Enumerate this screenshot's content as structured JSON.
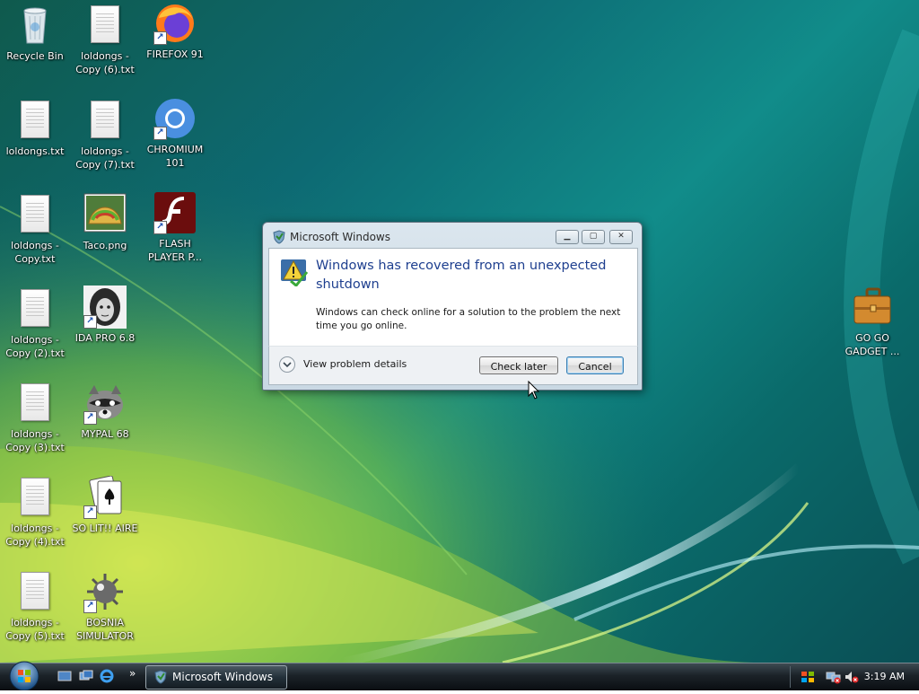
{
  "desktop_icons": [
    {
      "label": "Recycle Bin",
      "icon": "recycle-bin-icon"
    },
    {
      "label": "loldongs -\nCopy (6).txt",
      "icon": "text-file-icon"
    },
    {
      "label": "FIREFOX 91",
      "icon": "firefox-icon"
    },
    {
      "label": "loldongs.txt",
      "icon": "text-file-icon"
    },
    {
      "label": "loldongs -\nCopy (7).txt",
      "icon": "text-file-icon"
    },
    {
      "label": "CHROMIUM\n101",
      "icon": "chromium-icon"
    },
    {
      "label": "loldongs -\nCopy.txt",
      "icon": "text-file-icon"
    },
    {
      "label": "Taco.png",
      "icon": "image-file-icon"
    },
    {
      "label": "FLASH\nPLAYER P...",
      "icon": "flash-player-icon"
    },
    {
      "label": "loldongs -\nCopy (2).txt",
      "icon": "text-file-icon"
    },
    {
      "label": "IDA PRO 6.8",
      "icon": "ida-pro-icon"
    },
    {
      "label": "loldongs -\nCopy (3).txt",
      "icon": "text-file-icon"
    },
    {
      "label": "MYPAL 68",
      "icon": "mypal-icon"
    },
    {
      "label": "loldongs -\nCopy (4).txt",
      "icon": "text-file-icon"
    },
    {
      "label": "SO LIT!! AIRE",
      "icon": "solitaire-icon"
    },
    {
      "label": "loldongs -\nCopy (5).txt",
      "icon": "text-file-icon"
    },
    {
      "label": "BOSNIA\nSIMULATOR",
      "icon": "minesweeper-icon"
    },
    {
      "label": "GO GO\nGADGET ...",
      "icon": "briefcase-icon"
    }
  ],
  "dialog": {
    "title": "Microsoft Windows",
    "heading": "Windows has recovered from an unexpected shutdown",
    "body": "Windows can check online for a solution to the problem the next time you go online.",
    "details_label": "View problem details",
    "check_later_label": "Check later",
    "cancel_label": "Cancel"
  },
  "taskbar": {
    "start_label": "Start",
    "task_button_label": "Microsoft Windows",
    "clock": "3:19 AM",
    "quick_launch_more": "»"
  }
}
